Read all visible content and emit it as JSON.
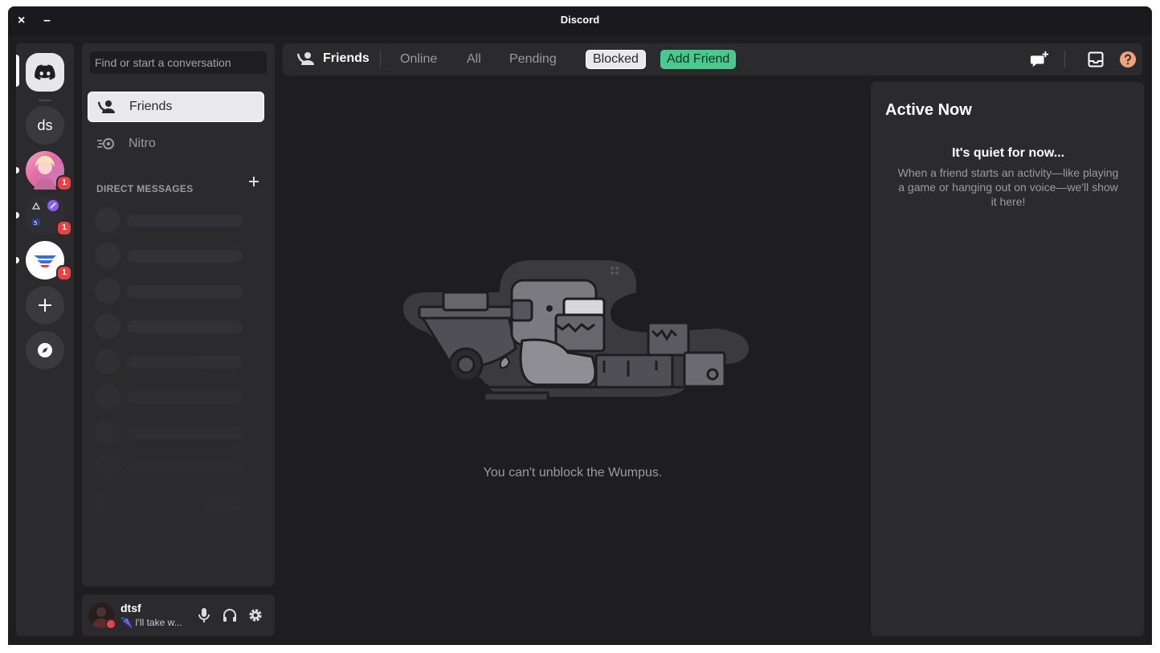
{
  "window": {
    "title": "Discord",
    "close_label": "×",
    "minimize_label": "–"
  },
  "servers": {
    "home_label": "Direct Messages",
    "items": [
      {
        "text": "ds"
      },
      {
        "badge": "1"
      },
      {
        "badge": "1"
      },
      {
        "badge": "1"
      }
    ],
    "add_label": "Add a Server",
    "explore_label": "Explore Discoverable Servers"
  },
  "dm_panel": {
    "search_placeholder": "Find or start a conversation",
    "nav": {
      "friends": "Friends",
      "nitro": "Nitro"
    },
    "section_header": "DIRECT MESSAGES"
  },
  "user": {
    "name": "dtsf",
    "status": "🌂 I'll take w..."
  },
  "header": {
    "title": "Friends",
    "tabs": {
      "online": "Online",
      "all": "All",
      "pending": "Pending",
      "blocked": "Blocked",
      "add_friend": "Add Friend"
    },
    "selected_tab": "Blocked"
  },
  "main": {
    "empty_message": "You can't unblock the Wumpus."
  },
  "active_now": {
    "title": "Active Now",
    "quiet_title": "It's quiet for now...",
    "quiet_desc": "When a friend starts an activity—like playing a game or hanging out on voice—we'll show it here!"
  },
  "colors": {
    "accent_green": "#49c98e",
    "badge_red": "#ed4245",
    "help_orange": "#f0a27a",
    "bg": "#1e1e21",
    "panel": "#2b2b2e"
  }
}
